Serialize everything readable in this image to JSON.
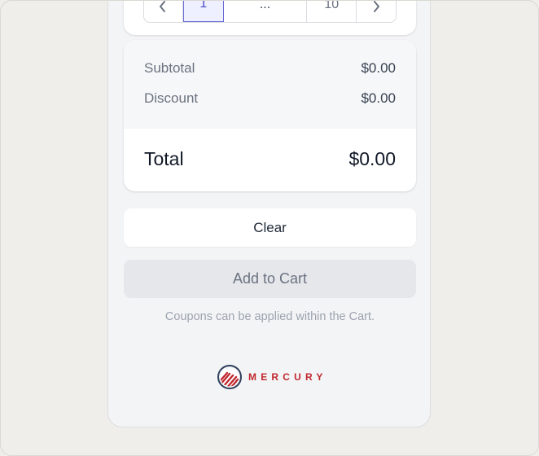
{
  "pagination": {
    "prev_icon": "chevron-left-icon",
    "pages": [
      "1",
      "...",
      "10"
    ],
    "next_icon": "chevron-right-icon",
    "current_page": "1"
  },
  "totals": {
    "subtotal_label": "Subtotal",
    "subtotal_value": "$0.00",
    "discount_label": "Discount",
    "discount_value": "$0.00",
    "total_label": "Total",
    "total_value": "$0.00"
  },
  "actions": {
    "clear_label": "Clear",
    "add_to_cart_label": "Add to Cart"
  },
  "note": "Coupons can be applied within the Cart.",
  "brand": {
    "name": "MERCURY",
    "color": "#c0282e"
  },
  "colors": {
    "accent": "#6b6bd6",
    "disabled_button": "#e5e7eb"
  }
}
